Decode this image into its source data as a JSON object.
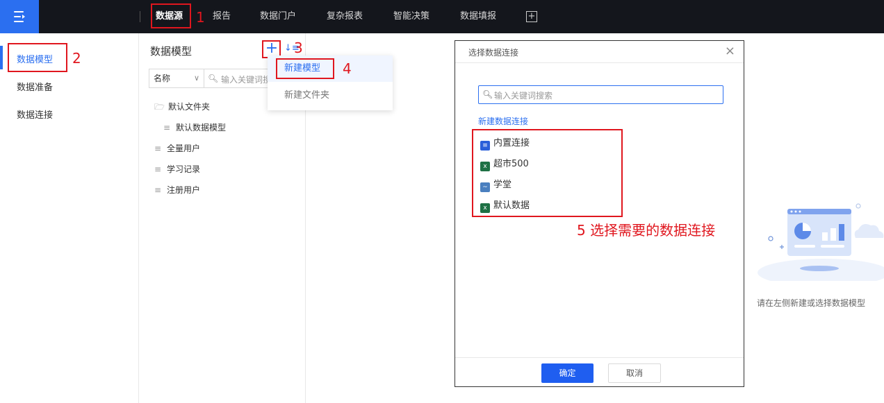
{
  "topbar": {
    "nav": [
      "数据源",
      "报告",
      "数据门户",
      "复杂报表",
      "智能决策",
      "数据填报"
    ],
    "add_icon": "add-tab-icon",
    "menu_icon": "menu-collapse-icon"
  },
  "sidebar": {
    "items": [
      "数据模型",
      "数据准备",
      "数据连接"
    ]
  },
  "panel": {
    "title": "数据模型",
    "add_icon_glyph": "+",
    "sort_icon_glyph": "↓≡",
    "select_value": "名称",
    "search_placeholder": "输入关键词搜",
    "tree": [
      {
        "label": "默认文件夹",
        "icon": "folder-icon"
      },
      {
        "label": "默认数据模型",
        "icon": "database-icon"
      },
      {
        "label": "全量用户",
        "icon": "database-icon"
      },
      {
        "label": "学习记录",
        "icon": "database-icon"
      },
      {
        "label": "注册用户",
        "icon": "database-icon"
      }
    ]
  },
  "menu": {
    "items": [
      "新建模型",
      "新建文件夹"
    ]
  },
  "dialog": {
    "title": "选择数据连接",
    "search_placeholder": "输入关键词搜索",
    "new_connection": "新建数据连接",
    "connections": [
      {
        "label": "内置连接",
        "icon": "builtin-db-icon"
      },
      {
        "label": "超市500",
        "icon": "excel-icon"
      },
      {
        "label": "学堂",
        "icon": "db-brand-icon"
      },
      {
        "label": "默认数据",
        "icon": "excel-icon"
      }
    ],
    "ok": "确定",
    "cancel": "取消"
  },
  "annotations": {
    "n1": "1",
    "n2": "2",
    "n3": "3",
    "n4": "4",
    "n5": "5 选择需要的数据连接"
  },
  "empty_state": {
    "text": "请在左侧新建或选择数据模型"
  },
  "colors": {
    "accent": "#2b6ff0",
    "topbar": "#14161c",
    "annotation": "#e0161e"
  }
}
